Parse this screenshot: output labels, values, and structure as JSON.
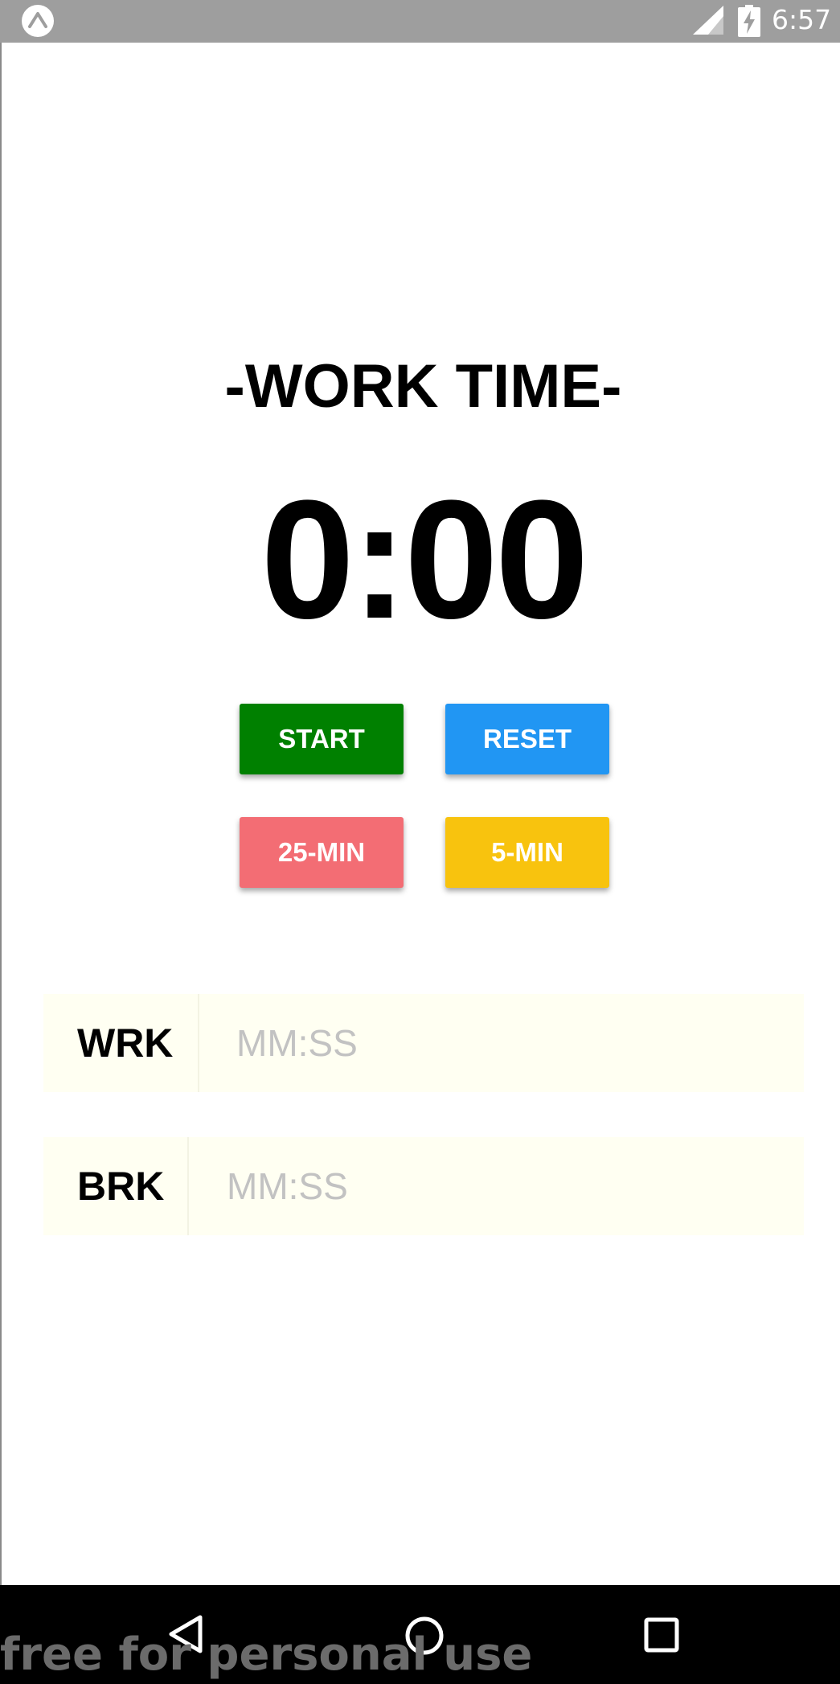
{
  "status_bar": {
    "time": "6:57",
    "icons": [
      "expo-icon",
      "signal-icon",
      "battery-charging-icon"
    ]
  },
  "timer": {
    "mode_label": "-WORK TIME-",
    "display": "0:00"
  },
  "buttons": {
    "start": "START",
    "reset": "RESET",
    "preset_work": "25-MIN",
    "preset_break": "5-MIN"
  },
  "inputs": {
    "work": {
      "label": "WRK",
      "value": "",
      "placeholder": "MM:SS"
    },
    "break": {
      "label": "BRK",
      "value": "",
      "placeholder": "MM:SS"
    }
  },
  "nav_bar": {
    "icons": [
      "back-icon",
      "home-icon",
      "recents-icon"
    ]
  },
  "watermark": "free for personal use",
  "colors": {
    "status_bar": "#9e9e9e",
    "start": "#008000",
    "reset": "#2196f3",
    "preset_work": "#f36d74",
    "preset_break": "#f8c30e",
    "input_background": "#fffff2"
  }
}
